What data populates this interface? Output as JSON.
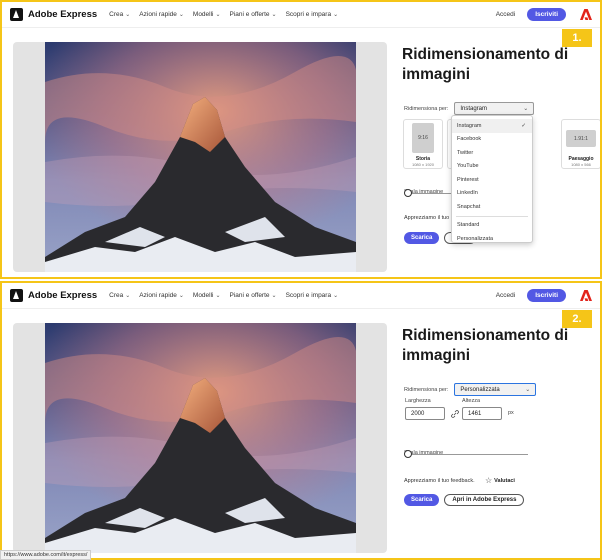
{
  "nav": {
    "brand": "Adobe Express",
    "menu": [
      "Crea",
      "Azioni rapide",
      "Modelli",
      "Piani e offerte",
      "Scopri e impara"
    ],
    "accedi": "Accedi",
    "iscriviti": "Iscriviti"
  },
  "steps": [
    "1.",
    "2."
  ],
  "title": "Ridimensionamento di immagini",
  "resize_label": "Ridimensiona per:",
  "panel1": {
    "select_value": "Instagram",
    "cards": [
      {
        "thumb": "9:16",
        "name": "Storia",
        "size": "1080 x 1920"
      },
      {
        "thumb": "",
        "name": "",
        "size": ""
      },
      {
        "thumb": "1.91:1",
        "name": "Paesaggio",
        "size": "1080 x 566"
      }
    ],
    "scale_label": "Scala immagine",
    "feedback": "Apprezziamo il tuo",
    "download": "Scarica",
    "open_partial": "Apri i",
    "dropdown": {
      "items": [
        "Instagram",
        "Facebook",
        "Twitter",
        "YouTube",
        "Pinterest",
        "LinkedIn",
        "Snapchat"
      ],
      "items2": [
        "Standard",
        "Personalizzata"
      ],
      "check": "✓"
    }
  },
  "panel2": {
    "select_value": "Personalizzata",
    "width_label": "Larghezza",
    "height_label": "Altezza",
    "width_value": "2000",
    "height_value": "1461",
    "unit": "px",
    "scale_label": "Scala immagine",
    "feedback": "Apprezziamo il tuo feedback.",
    "rate": "Valutaci",
    "download": "Scarica",
    "open": "Apri in Adobe Express"
  },
  "status_url": "https://www.adobe.com/it/express/",
  "colors": {
    "accent": "#5258e4",
    "highlight": "#f5c518",
    "focus": "#2b74e0"
  }
}
